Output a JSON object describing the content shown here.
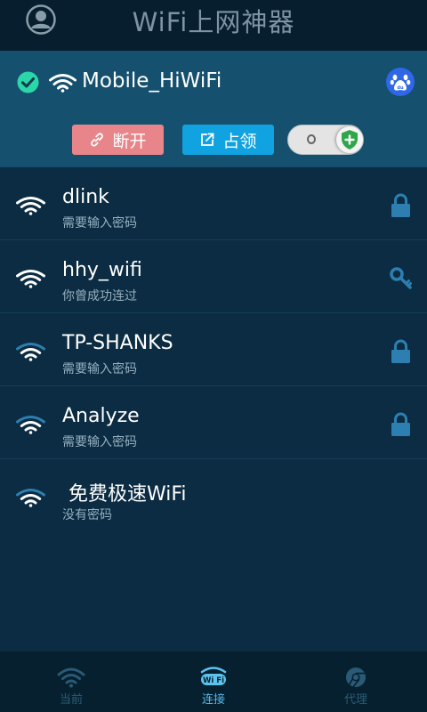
{
  "header": {
    "title": "WiFi上网神器",
    "avatar_icon": "user-circle-icon"
  },
  "connected": {
    "ssid": "Mobile_HiWiFi",
    "status_icon": "check-circle-icon",
    "baidu_icon": "baidu-paw-icon",
    "disconnect_label": "断开",
    "occupy_label": "占领",
    "toggle_state": "off",
    "toggle_off_glyph": "O",
    "colors": {
      "disconnect": "#e8858a",
      "occupy": "#11a2e2",
      "check": "#2bd6a8",
      "shield": "#2fa64a"
    }
  },
  "networks": [
    {
      "name": "dlink",
      "status": "需要输入密码",
      "lock": "lock-icon",
      "signal": "strong"
    },
    {
      "name": "hhy_wifi",
      "status": "你曾成功连过",
      "lock": "key-icon",
      "signal": "strong"
    },
    {
      "name": "TP-SHANKS",
      "status": "需要输入密码",
      "lock": "lock-icon",
      "signal": "medium"
    },
    {
      "name": "Analyze",
      "status": "需要输入密码",
      "lock": "lock-icon",
      "signal": "medium"
    },
    {
      "name": " 免费极速WiFi",
      "status": "没有密码",
      "lock": "",
      "signal": "medium"
    }
  ],
  "nav": {
    "items": [
      {
        "label": "当前",
        "icon": "wifi-signal-icon",
        "active": false
      },
      {
        "label": "连接",
        "icon": "wifi-badge-icon",
        "active": true,
        "badge": "Wi Fi"
      },
      {
        "label": "代理",
        "icon": "chrome-icon",
        "active": false
      }
    ]
  }
}
